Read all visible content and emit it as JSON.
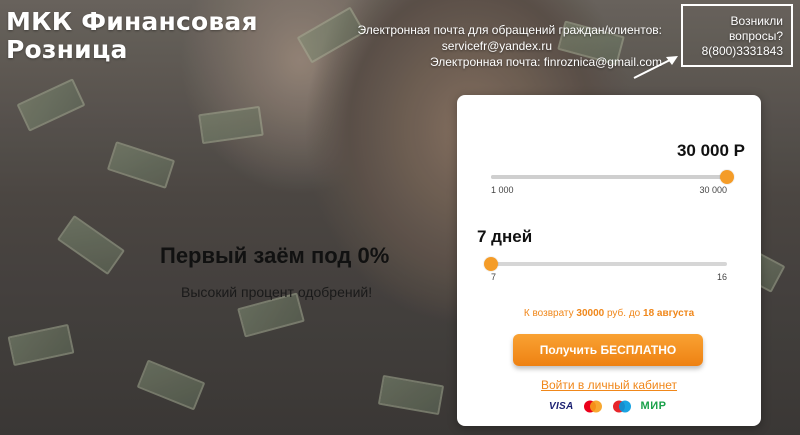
{
  "brand": {
    "line1": "МКК Финансовая",
    "line2": "Розница"
  },
  "contacts": {
    "label": "Электронная почта для обращений граждан/клиентов:",
    "email_clients": "servicefr@yandex.ru",
    "email_main": "Электронная почта: finroznica@gmail.com"
  },
  "questions": {
    "line1": "Возникли",
    "line2": "вопросы?",
    "phone": "8(800)3331843"
  },
  "promo": {
    "title": "Первый заём под 0%",
    "subtitle": "Высокий процент одобрений!"
  },
  "calculator": {
    "amount": {
      "value_label": "30 000 Р",
      "min": 1000,
      "max": 30000,
      "current": 30000,
      "min_label": "1 000",
      "max_label": "30 000"
    },
    "term": {
      "value_label": "7 дней",
      "min": 7,
      "max": 16,
      "current": 7,
      "min_label": "7",
      "max_label": "16"
    },
    "repay": {
      "prefix": "К возврату",
      "sum": "30000",
      "currency": "руб. до",
      "date": "18 августа"
    },
    "cta_label": "Получить БЕСПЛАТНО",
    "cabinet_link": "Войти в личный кабинет",
    "payment_methods": [
      "VISA",
      "mastercard-icon",
      "maestro-icon",
      "МИР"
    ]
  },
  "colors": {
    "accent": "#f49c28",
    "link": "#f0871a",
    "button": "#ee8112"
  }
}
